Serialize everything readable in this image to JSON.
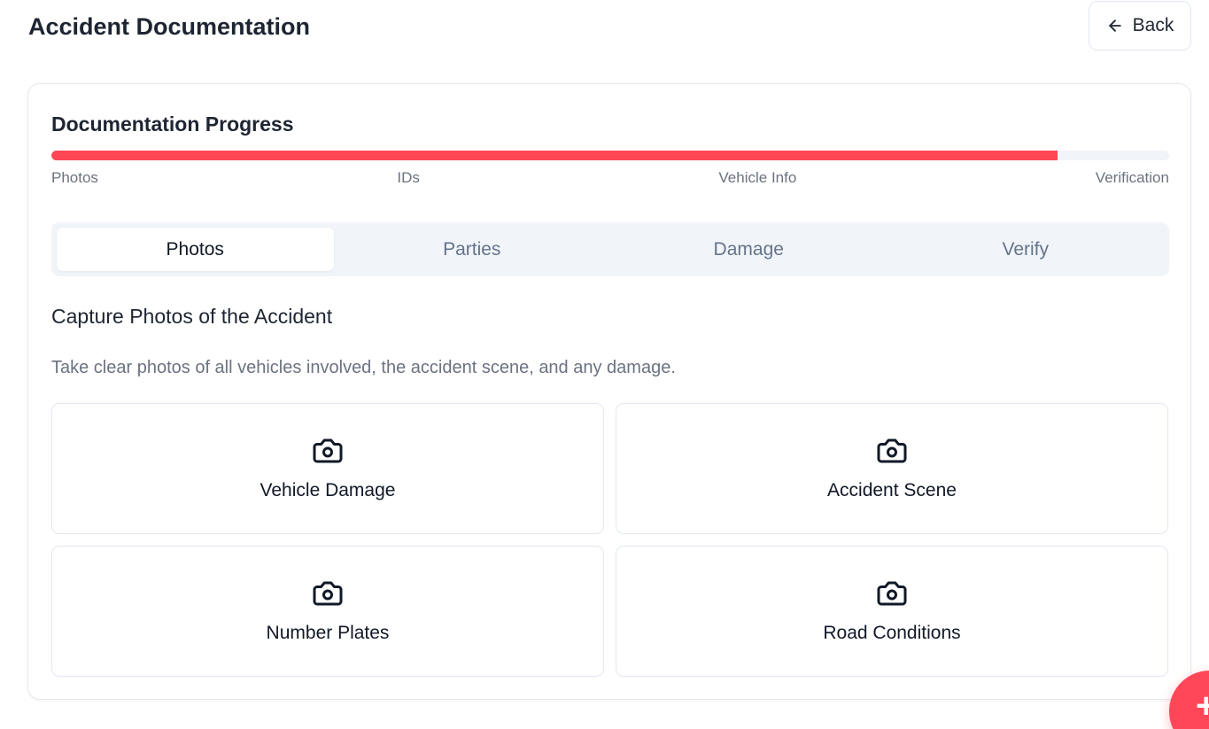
{
  "header": {
    "title": "Accident Documentation",
    "back_label": "Back"
  },
  "progress": {
    "title": "Documentation Progress",
    "fraction": 0.9,
    "fill_color": "#ff4757",
    "steps": [
      "Photos",
      "IDs",
      "Vehicle Info",
      "Verification"
    ]
  },
  "tabs": [
    {
      "label": "Photos",
      "active": true
    },
    {
      "label": "Parties",
      "active": false
    },
    {
      "label": "Damage",
      "active": false
    },
    {
      "label": "Verify",
      "active": false
    }
  ],
  "section": {
    "title": "Capture Photos of the Accident",
    "description": "Take clear photos of all vehicles involved, the accident scene, and any damage."
  },
  "photo_tiles": [
    {
      "label": "Vehicle Damage",
      "icon": "camera-icon"
    },
    {
      "label": "Accident Scene",
      "icon": "camera-icon"
    },
    {
      "label": "Number Plates",
      "icon": "camera-icon"
    },
    {
      "label": "Road Conditions",
      "icon": "camera-icon"
    }
  ],
  "fab": {
    "icon": "plus-icon",
    "glyph": "+",
    "color": "#ff4757"
  }
}
